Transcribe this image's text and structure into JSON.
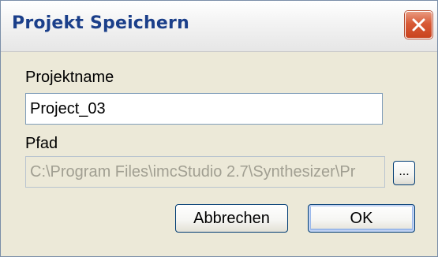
{
  "dialog": {
    "title": "Projekt Speichern",
    "close_icon": "close-icon",
    "project_name_label": "Projektname",
    "project_name_value": "Project_03",
    "path_label": "Pfad",
    "path_value": "C:\\Program Files\\imcStudio 2.7\\Synthesizer\\Pr",
    "browse_label": "...",
    "cancel_label": "Abbrechen",
    "ok_label": "OK"
  },
  "colors": {
    "title_text": "#1b3f8a",
    "close_button": "#d85a36",
    "dialog_background": "#ece9d8",
    "disabled_text": "#a19f92"
  }
}
